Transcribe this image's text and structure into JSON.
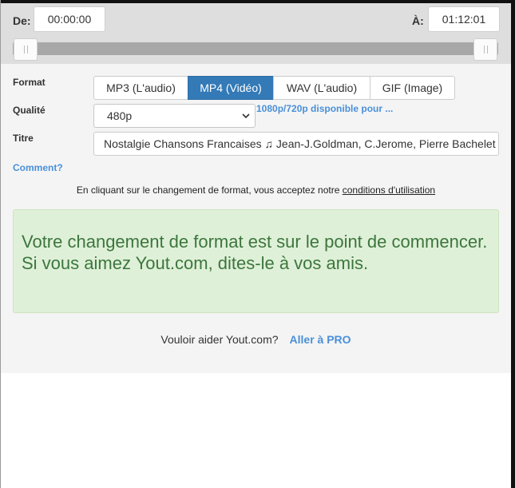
{
  "range": {
    "from_label": "De:",
    "from_value": "00:00:00",
    "to_label": "À:",
    "to_value": "01:12:01"
  },
  "format": {
    "label": "Format",
    "options": [
      "MP3 (L'audio)",
      "MP4 (Vidéo)",
      "WAV (L'audio)",
      "GIF (Image)"
    ],
    "selected": "MP4 (Vidéo)"
  },
  "quality": {
    "label": "Qualité",
    "value": "480p",
    "hd_note": "1080p/720p disponible pour ..."
  },
  "title_field": {
    "label": "Titre",
    "value": "Nostalgie Chansons Francaises ♫ Jean-J.Goldman, C.Jerome, Pierre Bachelet"
  },
  "help_link": "Comment?",
  "terms": {
    "text": "En cliquant sur le changement de format, vous acceptez notre ",
    "link": "conditions d'utilisation"
  },
  "alert": {
    "message": "Votre changement de format est sur le point de commencer. Si vous aimez Yout.com, dites-le à vos amis."
  },
  "pro": {
    "question": "Vouloir aider Yout.com?",
    "link": "Aller à PRO"
  },
  "colors": {
    "accent": "#337ab7",
    "link": "#4a90d9",
    "success_bg": "#dff0d8",
    "success_text": "#3c763d"
  }
}
